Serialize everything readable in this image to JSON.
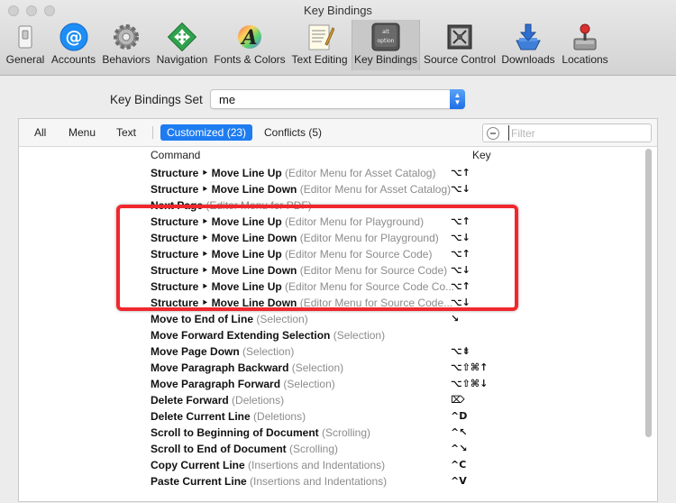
{
  "window": {
    "title": "Key Bindings"
  },
  "toolbar": {
    "items": [
      {
        "label": "General",
        "icon": "general-switch-icon"
      },
      {
        "label": "Accounts",
        "icon": "accounts-at-icon"
      },
      {
        "label": "Behaviors",
        "icon": "behaviors-gear-icon"
      },
      {
        "label": "Navigation",
        "icon": "navigation-arrows-icon"
      },
      {
        "label": "Fonts & Colors",
        "icon": "fonts-colors-icon"
      },
      {
        "label": "Text Editing",
        "icon": "text-editing-icon"
      },
      {
        "label": "Key Bindings",
        "icon": "key-bindings-icon",
        "active": true,
        "keycap_top": "alt",
        "keycap_bottom": "option"
      },
      {
        "label": "Source Control",
        "icon": "source-control-icon"
      },
      {
        "label": "Downloads",
        "icon": "downloads-icon"
      },
      {
        "label": "Locations",
        "icon": "locations-joystick-icon"
      }
    ]
  },
  "key_bindings_set": {
    "label": "Key Bindings Set",
    "value": "me"
  },
  "filter_tabs": {
    "all": "All",
    "menu": "Menu",
    "text": "Text",
    "customized": "Customized (23)",
    "conflicts": "Conflicts (5)"
  },
  "filter": {
    "placeholder": "Filter"
  },
  "columns": {
    "command": "Command",
    "key": "Key"
  },
  "rows": [
    {
      "command": "Structure ‣ Move Line Up",
      "context": "(Editor Menu for Asset Catalog)",
      "key": "⌥↑"
    },
    {
      "command": "Structure ‣ Move Line Down",
      "context": "(Editor Menu for Asset Catalog)",
      "key": "⌥↓"
    },
    {
      "command": "Next Page",
      "context": "(Editor Menu for PDF)",
      "key": ""
    },
    {
      "command": "Structure ‣ Move Line Up",
      "context": "(Editor Menu for Playground)",
      "key": "⌥↑"
    },
    {
      "command": "Structure ‣ Move Line Down",
      "context": "(Editor Menu for Playground)",
      "key": "⌥↓"
    },
    {
      "command": "Structure ‣ Move Line Up",
      "context": "(Editor Menu for Source Code)",
      "key": "⌥↑"
    },
    {
      "command": "Structure ‣ Move Line Down",
      "context": "(Editor Menu for Source Code)",
      "key": "⌥↓"
    },
    {
      "command": "Structure ‣ Move Line Up",
      "context": "(Editor Menu for Source Code Co...",
      "key": "⌥↑"
    },
    {
      "command": "Structure ‣ Move Line Down",
      "context": "(Editor Menu for Source Code...",
      "key": "⌥↓"
    },
    {
      "command": "Move to End of Line",
      "context": "(Selection)",
      "key": "↘"
    },
    {
      "command": "Move Forward Extending Selection",
      "context": "(Selection)",
      "key": ""
    },
    {
      "command": "Move Page Down",
      "context": "(Selection)",
      "key": "⌥⇟"
    },
    {
      "command": "Move Paragraph Backward",
      "context": "(Selection)",
      "key": "⌥⇧⌘↑"
    },
    {
      "command": "Move Paragraph Forward",
      "context": "(Selection)",
      "key": "⌥⇧⌘↓"
    },
    {
      "command": "Delete Forward",
      "context": "(Deletions)",
      "key": "⌦"
    },
    {
      "command": "Delete Current Line",
      "context": "(Deletions)",
      "key": "^D"
    },
    {
      "command": "Scroll to Beginning of Document",
      "context": "(Scrolling)",
      "key": "^↖"
    },
    {
      "command": "Scroll to End of Document",
      "context": "(Scrolling)",
      "key": "^↘"
    },
    {
      "command": "Copy Current Line",
      "context": "(Insertions and Indentations)",
      "key": "^C"
    },
    {
      "command": "Paste Current Line",
      "context": "(Insertions and Indentations)",
      "key": "^V"
    }
  ],
  "colors": {
    "accent": "#1e7cf0",
    "highlight_box": "#f0282d",
    "context_text": "#8c8c8c"
  }
}
